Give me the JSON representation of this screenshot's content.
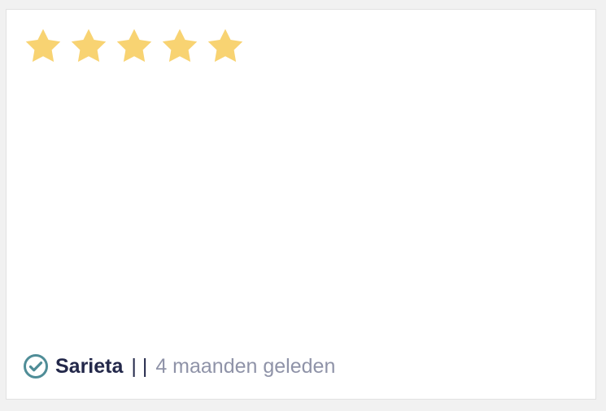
{
  "review": {
    "rating": 5,
    "max_rating": 5,
    "author": "Sarieta",
    "separator": "| |",
    "time_ago": "4 maanden geleden"
  },
  "icons": {
    "star": "star-icon",
    "verified": "verified-check-icon"
  },
  "colors": {
    "star_fill": "#f8d372",
    "verified": "#4f8d97",
    "author": "#23284a",
    "muted": "#8f93a8"
  }
}
